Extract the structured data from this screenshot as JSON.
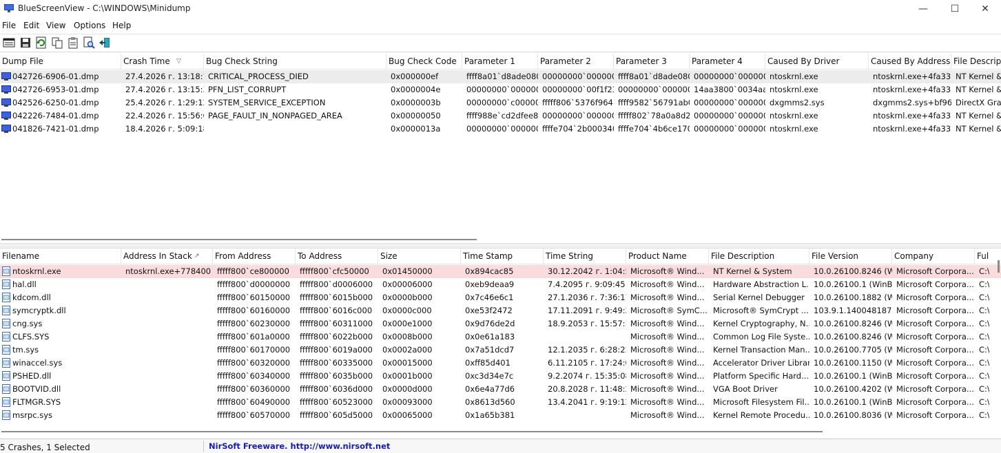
{
  "window": {
    "app_name": "BlueScreenView",
    "path": "C:\\WINDOWS\\Minidump",
    "minimize": "—",
    "maximize": "☐",
    "close": "✕"
  },
  "menu": [
    "File",
    "Edit",
    "View",
    "Options",
    "Help"
  ],
  "toolbar_icons": [
    "save-html-report-icon",
    "save-icon",
    "refresh-icon",
    "copy-icon",
    "properties-icon",
    "find-icon",
    "exit-icon"
  ],
  "top_table": {
    "columns": [
      "Dump File",
      "Crash Time",
      "Bug Check String",
      "Bug Check Code",
      "Parameter 1",
      "Parameter 2",
      "Parameter 3",
      "Parameter 4",
      "Caused By Driver",
      "Caused By Address",
      "File Descripti"
    ],
    "rows": [
      [
        "042726-6906-01.dmp",
        "27.4.2026 г. 13:18:16",
        "CRITICAL_PROCESS_DIED",
        "0x000000ef",
        "ffff8a01`d8ade080",
        "00000000`000000...",
        "ffff8a01`d8ade080",
        "00000000`000000...",
        "ntoskrnl.exe",
        "ntoskrnl.exe+4fa330",
        "NT Kernel &"
      ],
      [
        "042726-6953-01.dmp",
        "27.4.2026 г. 13:15:35",
        "PFN_LIST_CORRUPT",
        "0x0000004e",
        "00000000`000000...",
        "00000000`00f1f239",
        "00000000`000000...",
        "14aa3800`0034aa...",
        "ntoskrnl.exe",
        "ntoskrnl.exe+4fa330",
        "NT Kernel &"
      ],
      [
        "042526-6250-01.dmp",
        "25.4.2026 г. 1:29:12",
        "SYSTEM_SERVICE_EXCEPTION",
        "0x0000003b",
        "00000000`c00000...",
        "fffff806`5376f964",
        "ffff9582`56791ab0",
        "00000000`000000...",
        "dxgmms2.sys",
        "dxgmms2.sys+bf964",
        "DirectX Grap"
      ],
      [
        "042226-7484-01.dmp",
        "22.4.2026 г. 15:56:02",
        "PAGE_FAULT_IN_NONPAGED_AREA",
        "0x00000050",
        "ffff988e`cd2dfee8",
        "00000000`000000...",
        "fffff802`78a0a8d2",
        "00000000`000000...",
        "ntoskrnl.exe",
        "ntoskrnl.exe+4fa330",
        "NT Kernel &"
      ],
      [
        "041826-7421-01.dmp",
        "18.4.2026 г. 5:09:18",
        "",
        "0x0000013a",
        "00000000`000000...",
        "ffffe704`2b000340",
        "ffffe704`4b6ce170",
        "00000000`000000...",
        "ntoskrnl.exe",
        "ntoskrnl.exe+4fa330",
        "NT Kernel &"
      ]
    ]
  },
  "bottom_table": {
    "columns": [
      "Filename",
      "Address In Stack",
      "From Address",
      "To Address",
      "Size",
      "Time Stamp",
      "Time String",
      "Product Name",
      "File Description",
      "File Version",
      "Company",
      "Ful"
    ],
    "rows": [
      [
        "ntoskrnl.exe",
        "ntoskrnl.exe+778400",
        "fffff800`ce800000",
        "fffff800`cfc50000",
        "0x01450000",
        "0x894cac85",
        "30.12.2042 г. 1:04:53",
        "Microsoft® Wind...",
        "NT Kernel & System",
        "10.0.26100.8246 (W...",
        "Microsoft Corpora...",
        "C:\\"
      ],
      [
        "hal.dll",
        "",
        "fffff800`d0000000",
        "fffff800`d0006000",
        "0x00006000",
        "0xeb9deaa9",
        "7.4.2095 г. 9:09:45",
        "Microsoft® Wind...",
        "Hardware Abstraction L...",
        "10.0.26100.1 (WinB...",
        "Microsoft Corpora...",
        "C:\\"
      ],
      [
        "kdcom.dll",
        "",
        "fffff800`60150000",
        "fffff800`6015b000",
        "0x0000b000",
        "0x7c46e6c1",
        "27.1.2036 г. 7:36:17",
        "Microsoft® Wind...",
        "Serial Kernel Debugger",
        "10.0.26100.1882 (W...",
        "Microsoft Corpora...",
        "C:\\"
      ],
      [
        "symcryptk.dll",
        "",
        "fffff800`60160000",
        "fffff800`6016c000",
        "0x0000c000",
        "0xe53f2472",
        "17.11.2091 г. 9:49:22",
        "Microsoft® SymC...",
        "Microsoft® SymCrypt ...",
        "103.9.1.140048187",
        "Microsoft Corpora...",
        "C:\\"
      ],
      [
        "cng.sys",
        "",
        "fffff800`60230000",
        "fffff800`60311000",
        "0x000e1000",
        "0x9d76de2d",
        "18.9.2053 г. 15:57:17",
        "Microsoft® Wind...",
        "Kernel Cryptography, N...",
        "10.0.26100.8246 (W...",
        "Microsoft Corpora...",
        "C:\\"
      ],
      [
        "CLFS.SYS",
        "",
        "fffff800`601a0000",
        "fffff800`6022b000",
        "0x0008b000",
        "0x0e61a183",
        "",
        "Microsoft® Wind...",
        "Common Log File Syste...",
        "10.0.26100.8246 (W...",
        "Microsoft Corpora...",
        "C:\\"
      ],
      [
        "tm.sys",
        "",
        "fffff800`60170000",
        "fffff800`6019a000",
        "0x0002a000",
        "0x7a51dcd7",
        "12.1.2035 г. 6:28:23",
        "Microsoft® Wind...",
        "Kernel Transaction Man...",
        "10.0.26100.7705 (W...",
        "Microsoft Corpora...",
        "C:\\"
      ],
      [
        "winaccel.sys",
        "",
        "fffff800`60320000",
        "fffff800`60335000",
        "0x00015000",
        "0xff85d401",
        "6.11.2105 г. 17:24:01",
        "Microsoft® Wind...",
        "Accelerator Driver Library",
        "10.0.26100.1150 (W...",
        "Microsoft Corpora...",
        "C:\\"
      ],
      [
        "PSHED.dll",
        "",
        "fffff800`60340000",
        "fffff800`6035b000",
        "0x0001b000",
        "0xc3d34e7c",
        "9.2.2074 г. 15:35:08",
        "Microsoft® Wind...",
        "Platform Specific Hard...",
        "10.0.26100.1 (WinB...",
        "Microsoft Corpora...",
        "C:\\"
      ],
      [
        "BOOTVID.dll",
        "",
        "fffff800`60360000",
        "fffff800`6036d000",
        "0x0000d000",
        "0x6e4a77d6",
        "20.8.2028 г. 11:48:22",
        "Microsoft® Wind...",
        "VGA Boot Driver",
        "10.0.26100.4202 (W...",
        "Microsoft Corpora...",
        "C:\\"
      ],
      [
        "FLTMGR.SYS",
        "",
        "fffff800`60490000",
        "fffff800`60523000",
        "0x00093000",
        "0x8613d560",
        "13.4.2041 г. 9:19:12",
        "Microsoft® Wind...",
        "Microsoft Filesystem Fil...",
        "10.0.26100.1 (WinB...",
        "Microsoft Corpora...",
        "C:\\"
      ],
      [
        "msrpc.sys",
        "",
        "fffff800`60570000",
        "fffff800`605d5000",
        "0x00065000",
        "0x1a65b381",
        "",
        "Microsoft® Wind...",
        "Kernel Remote Procedu...",
        "10.0.26100.8036 (W...",
        "Microsoft Corpora...",
        "C:\\"
      ]
    ]
  },
  "status": {
    "left": "5 Crashes, 1 Selected",
    "right": "NirSoft Freeware.  http://www.nirsoft.net"
  },
  "colors": {
    "top_selected_row": "#ececec",
    "bottom_highlight_row": "#fadcdc",
    "link_blue": "#1a1ab5"
  }
}
